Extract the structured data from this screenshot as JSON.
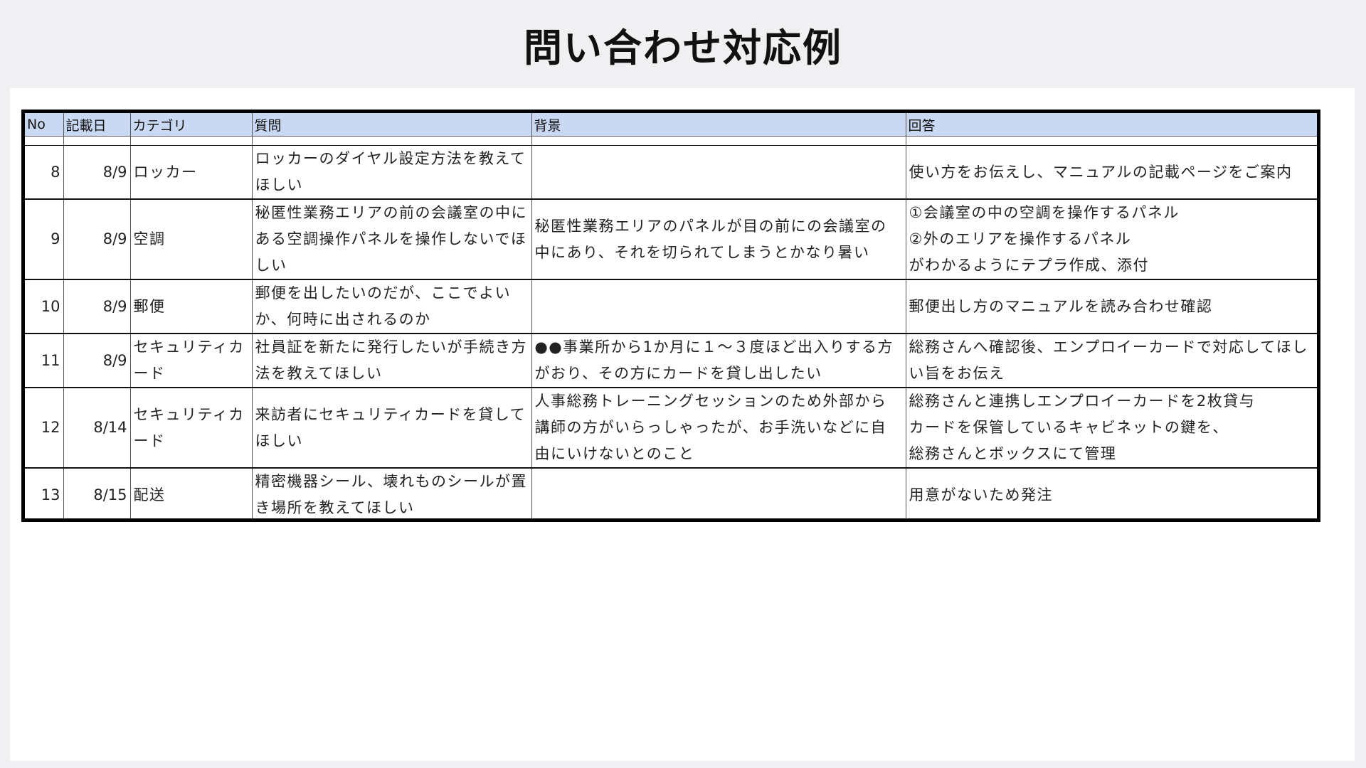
{
  "slide": {
    "title": "問い合わせ対応例"
  },
  "table": {
    "headers": {
      "no": "No",
      "date": "記載日",
      "category": "カテゴリ",
      "question": "質問",
      "background": "背景",
      "answer": "回答"
    },
    "rows": [
      {
        "no": "8",
        "date": "8/9",
        "category": "ロッカー",
        "question": "ロッカーのダイヤル設定方法を教えてほしい",
        "background": "",
        "answer": "使い方をお伝えし、マニュアルの記載ページをご案内"
      },
      {
        "no": "9",
        "date": "8/9",
        "category": "空調",
        "question": "秘匿性業務エリアの前の会議室の中にある空調操作パネルを操作しないでほしい",
        "background": "秘匿性業務エリアのパネルが目の前にの会議室の中にあり、それを切られてしまうとかなり暑い",
        "answer": "①会議室の中の空調を操作するパネル\n②外のエリアを操作するパネル\nがわかるようにテプラ作成、添付"
      },
      {
        "no": "10",
        "date": "8/9",
        "category": "郵便",
        "question": "郵便を出したいのだが、ここでよいか、何時に出されるのか",
        "background": "",
        "answer": "郵便出し方のマニュアルを読み合わせ確認"
      },
      {
        "no": "11",
        "date": "8/9",
        "category": "セキュリティカード",
        "question": "社員証を新たに発行したいが手続き方法を教えてほしい",
        "background": "●●事業所から1か月に１～３度ほど出入りする方がおり、その方にカードを貸し出したい",
        "answer": "総務さんへ確認後、エンプロイーカードで対応してほしい旨をお伝え"
      },
      {
        "no": "12",
        "date": "8/14",
        "category": "セキュリティカード",
        "question": "来訪者にセキュリティカードを貸してほしい",
        "background": "人事総務トレーニングセッションのため外部から講師の方がいらっしゃったが、お手洗いなどに自由にいけないとのこと",
        "answer": "総務さんと連携しエンプロイーカードを2枚貸与\nカードを保管しているキャビネットの鍵を、\n総務さんとボックスにて管理"
      },
      {
        "no": "13",
        "date": "8/15",
        "category": "配送",
        "question": "精密機器シール、壊れものシールが置き場所を教えてほしい",
        "background": "",
        "answer": "用意がないため発注"
      }
    ]
  }
}
